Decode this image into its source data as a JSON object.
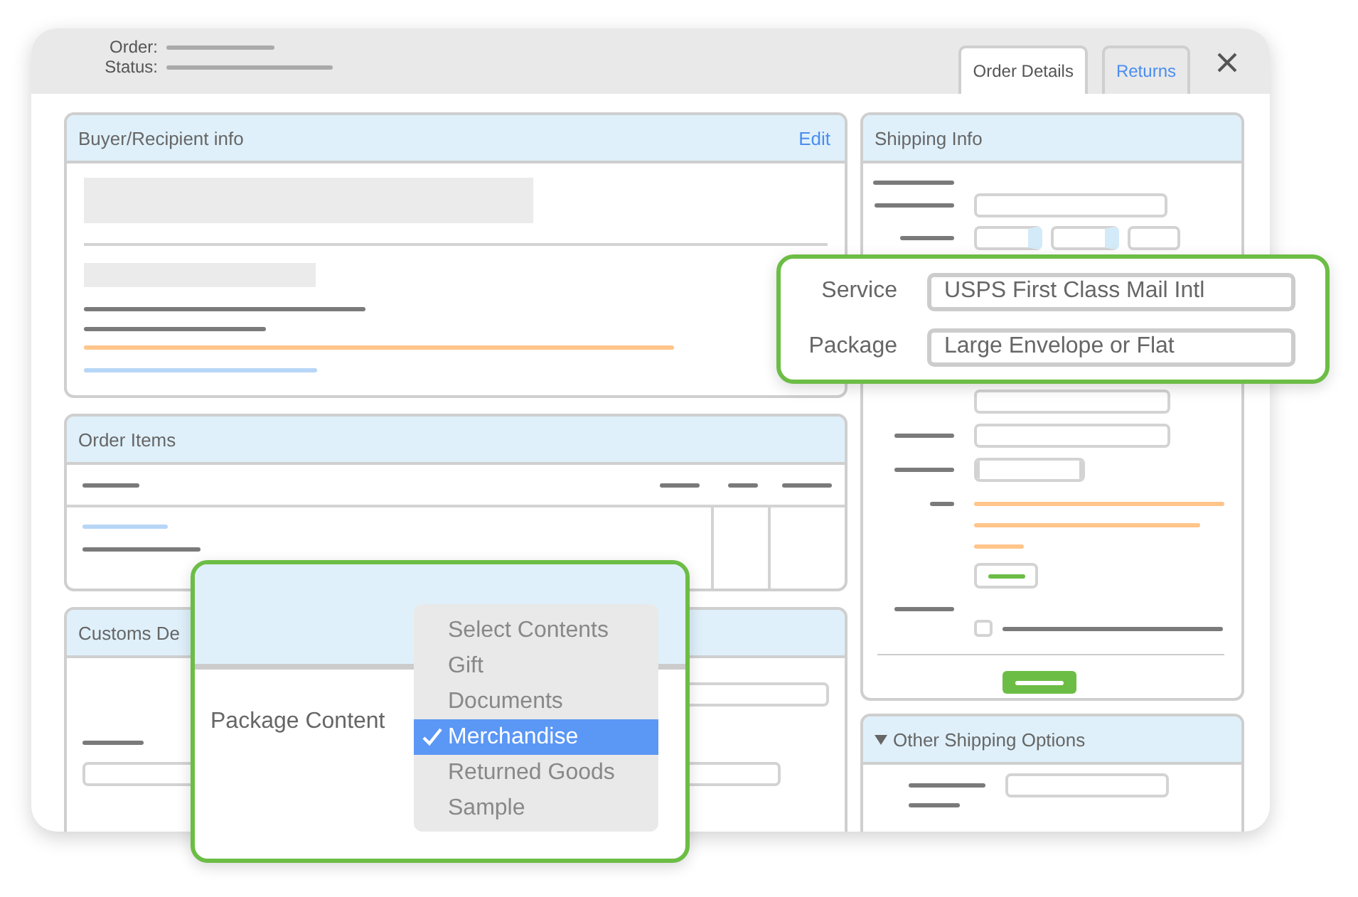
{
  "header": {
    "fields": [
      {
        "label": "Order:"
      },
      {
        "label": "Status:"
      }
    ]
  },
  "tabs": [
    {
      "label": "Order Details",
      "selected": true
    },
    {
      "label": "Returns",
      "selected": false
    }
  ],
  "buyer_panel": {
    "title": "Buyer/Recipient info",
    "action": "Edit"
  },
  "order_items_panel": {
    "title": "Order Items"
  },
  "customs_panel": {
    "title": "Customs De"
  },
  "shipping_panel": {
    "title": "Shipping Info",
    "option_checked": false
  },
  "other_options_panel": {
    "title": "Other Shipping Options",
    "expanded": true
  },
  "service_callout": {
    "fields": [
      {
        "label": "Service",
        "value": "USPS First Class Mail Intl"
      },
      {
        "label": "Package",
        "value": "Large Envelope or Flat"
      }
    ]
  },
  "content_callout": {
    "label": "Package Content",
    "options": [
      {
        "label": "Select Contents",
        "selected": false
      },
      {
        "label": "Gift",
        "selected": false
      },
      {
        "label": "Documents",
        "selected": false
      },
      {
        "label": "Merchandise",
        "selected": true
      },
      {
        "label": "Returned Goods",
        "selected": false
      },
      {
        "label": "Sample",
        "selected": false
      }
    ]
  }
}
